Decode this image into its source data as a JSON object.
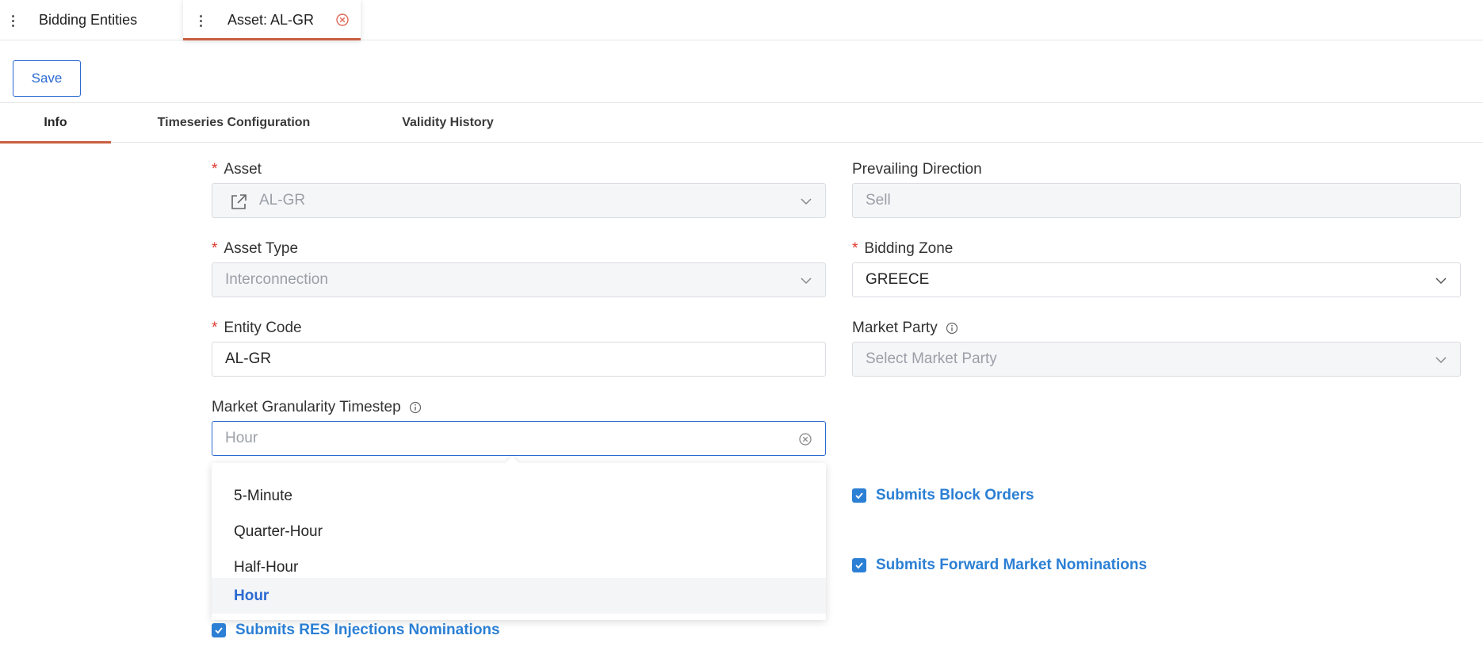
{
  "doc_tabs": [
    {
      "label": "Bidding Entities"
    },
    {
      "label": "Asset: AL-GR"
    }
  ],
  "toolbar": {
    "save_label": "Save"
  },
  "section_tabs": [
    {
      "label": "Info"
    },
    {
      "label": "Timeseries Configuration"
    },
    {
      "label": "Validity History"
    }
  ],
  "form": {
    "asset": {
      "label": "Asset",
      "value": "AL-GR"
    },
    "prevailing_direction": {
      "label": "Prevailing Direction",
      "value": "Sell"
    },
    "asset_type": {
      "label": "Asset Type",
      "value": "Interconnection"
    },
    "bidding_zone": {
      "label": "Bidding Zone",
      "value": "GREECE"
    },
    "entity_code": {
      "label": "Entity Code",
      "value": "AL-GR"
    },
    "market_party": {
      "label": "Market Party",
      "placeholder": "Select Market Party"
    },
    "market_granularity": {
      "label": "Market Granularity Timestep",
      "value": "Hour"
    }
  },
  "granularity_options": [
    "5-Minute",
    "Quarter-Hour",
    "Half-Hour",
    "Hour"
  ],
  "checkboxes": {
    "block_orders": "Submits Block Orders",
    "forward_nominations": "Submits Forward Market Nominations",
    "res_injections": "Submits RES Injections Nominations"
  },
  "colors": {
    "accent": "#2b6ad1",
    "tab_underline": "#c95f42",
    "required": "#e0352b"
  }
}
